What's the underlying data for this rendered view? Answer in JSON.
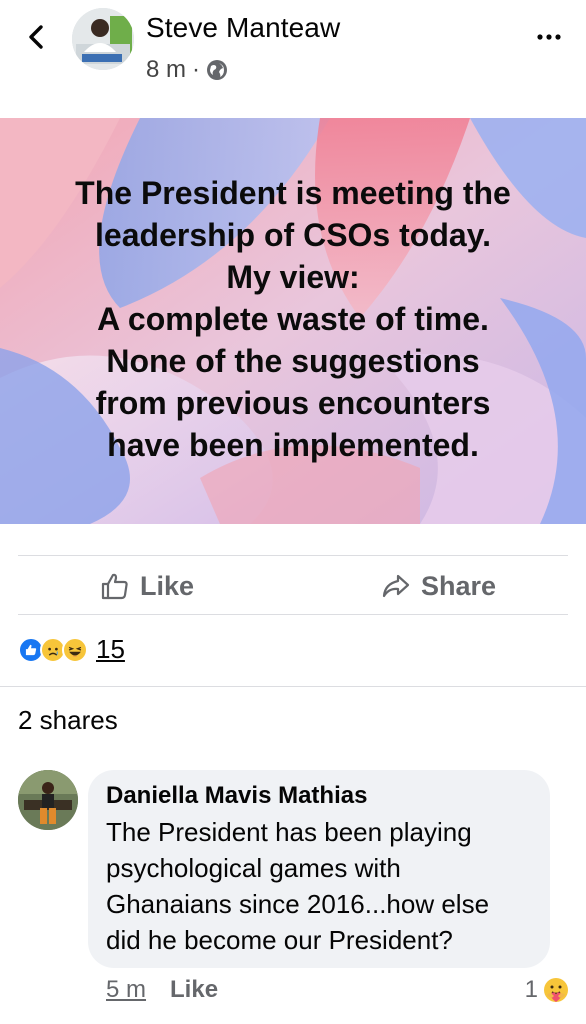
{
  "post": {
    "author": "Steve Manteaw",
    "time": "8 m",
    "separator": "·",
    "privacy_icon": "globe-icon",
    "lines": [
      "The President is meeting the",
      "leadership of CSOs today.",
      "My view:",
      "A complete waste of time.",
      "None of the suggestions",
      "from previous encounters",
      "have been implemented."
    ]
  },
  "actions": {
    "like_label": "Like",
    "share_label": "Share"
  },
  "reactions": {
    "icons": [
      "like-reaction-icon",
      "sad-reaction-icon",
      "haha-reaction-icon"
    ],
    "count": "15"
  },
  "shares_text": "2 shares",
  "comment": {
    "author": "Daniella Mavis Mathias",
    "lines": [
      "The President has been playing",
      "psychological games with",
      "Ghanaians since 2016...how else",
      "did he become our President?"
    ],
    "time": "5 m",
    "like_label": "Like",
    "reaction_count": "1",
    "reaction_icon": "care-reaction-icon"
  },
  "colors": {
    "like_blue": "#1877f2",
    "muted_text": "#65676b",
    "bubble": "#f0f2f5"
  }
}
